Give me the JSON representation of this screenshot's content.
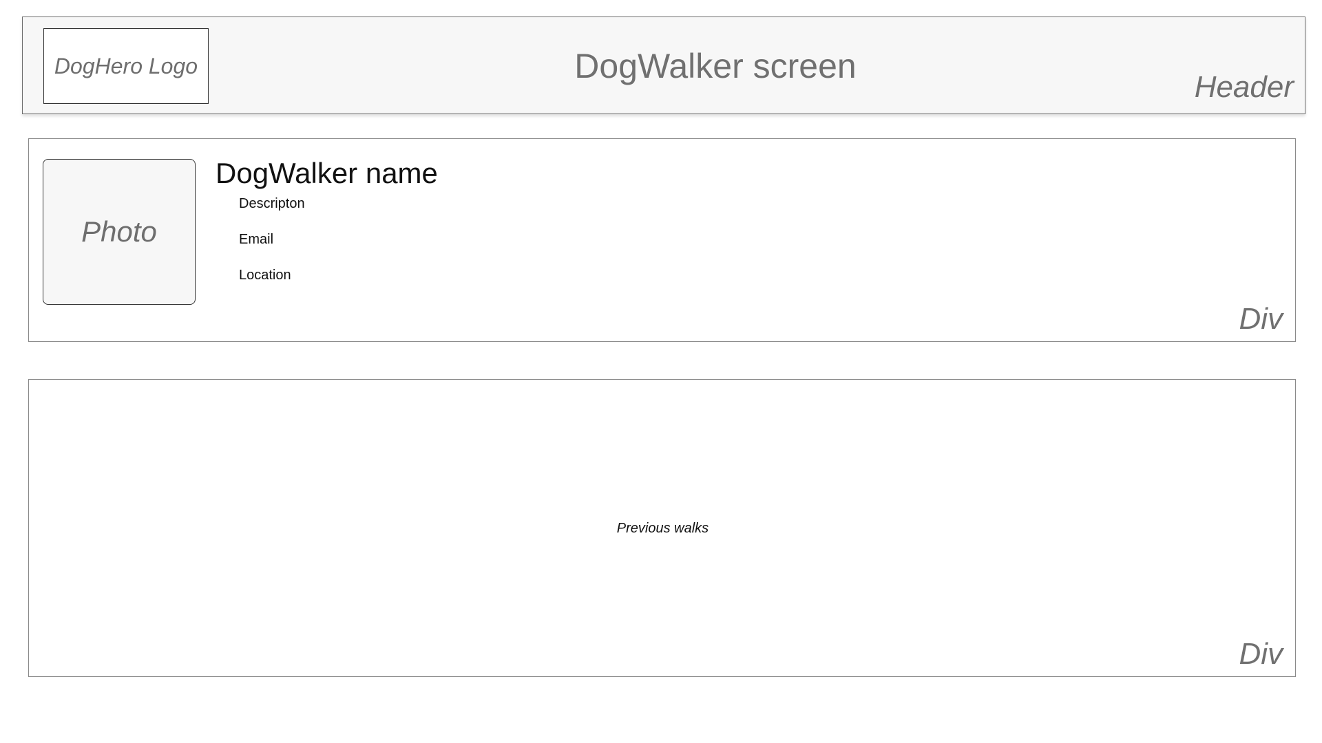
{
  "header": {
    "logo_text": "DogHero Logo",
    "title": "DogWalker screen",
    "region_label": "Header"
  },
  "profile": {
    "photo_label": "Photo",
    "name": "DogWalker name",
    "description": "Descripton",
    "email": "Email",
    "location": "Location",
    "region_label": "Div"
  },
  "walks": {
    "label": "Previous walks",
    "region_label": "Div"
  }
}
